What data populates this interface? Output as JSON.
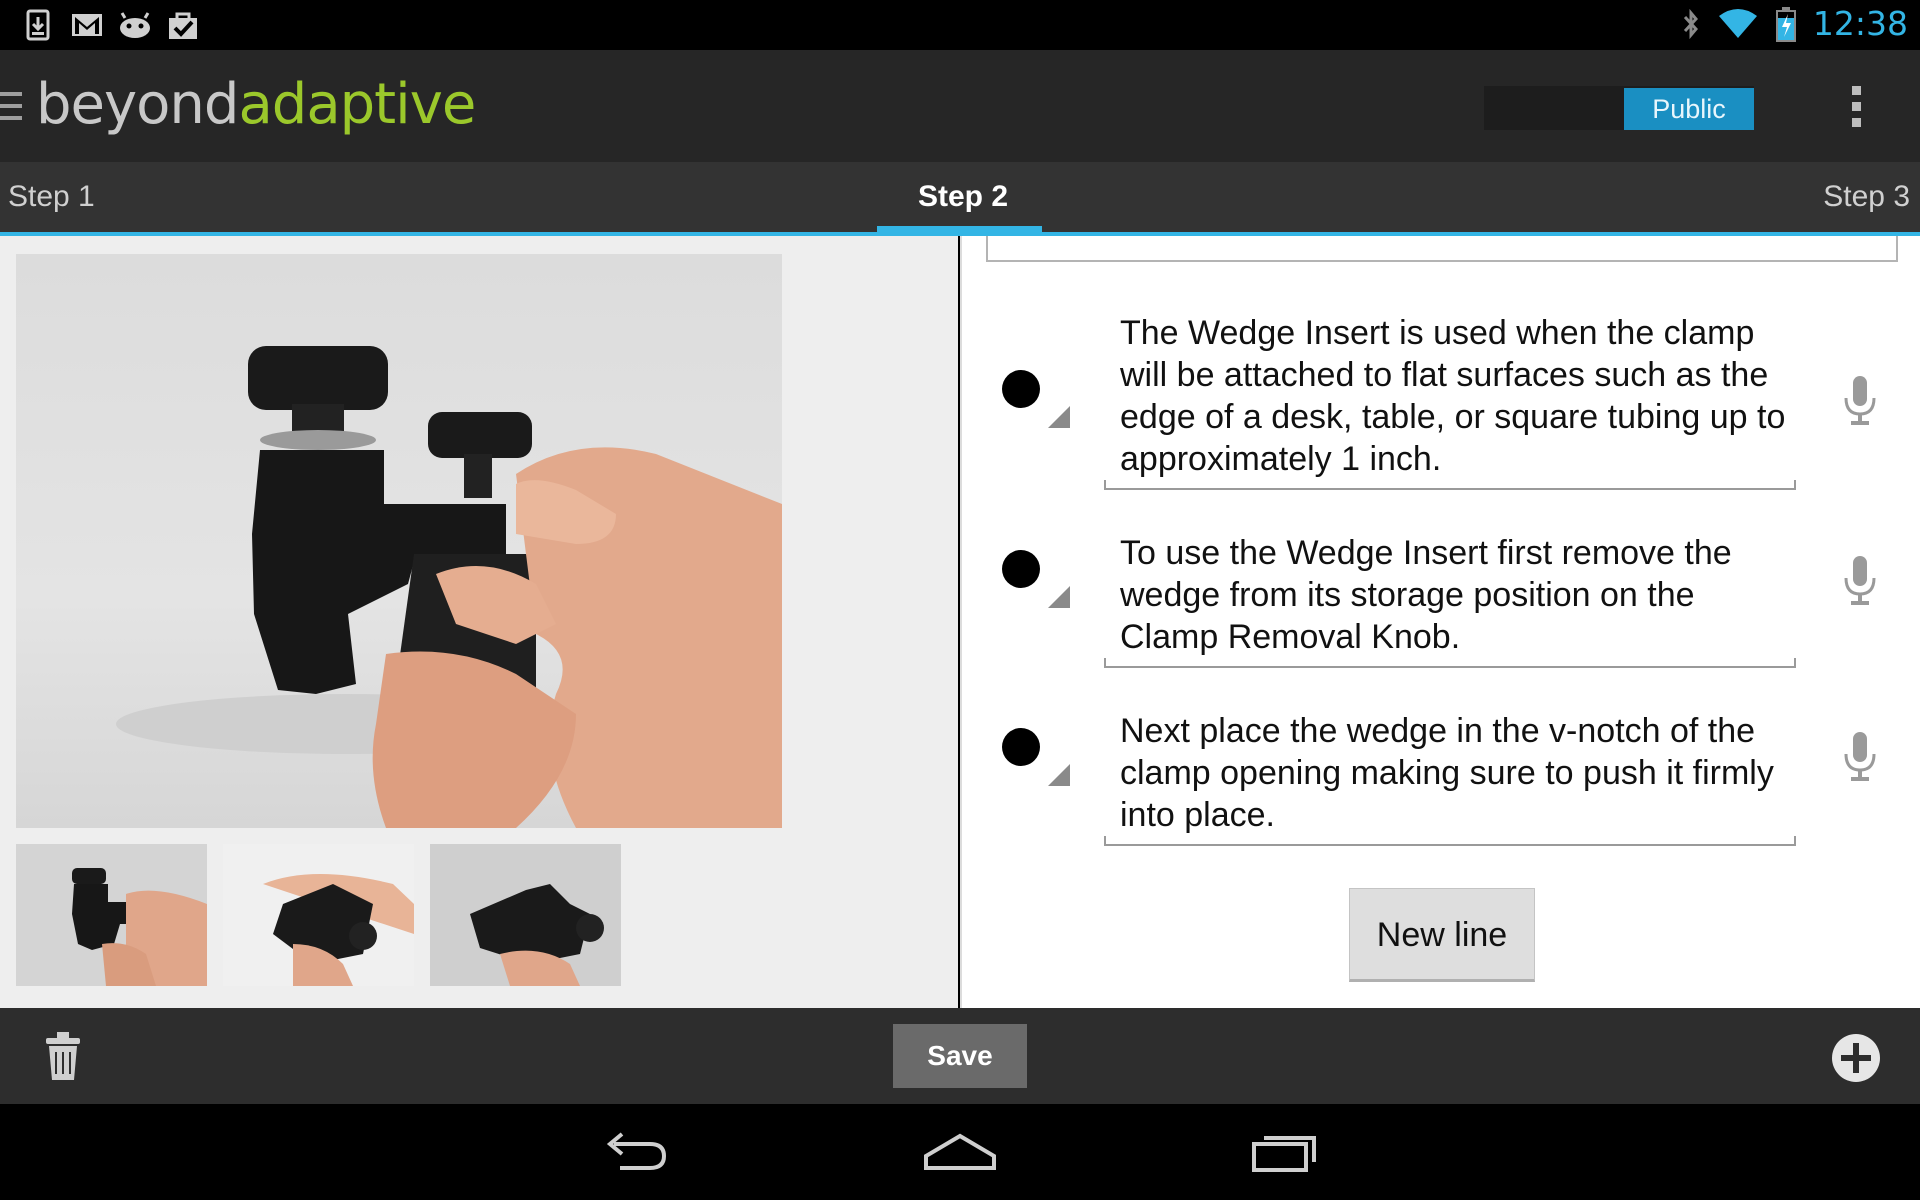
{
  "status_bar": {
    "time": "12:38",
    "notification_icons": [
      "download-icon",
      "gmail-icon",
      "android-icon",
      "shopping-bag-check-icon"
    ],
    "system_icons": [
      "bluetooth-icon",
      "wifi-icon",
      "battery-charging-icon"
    ],
    "accent_color": "#33b5e5"
  },
  "action_bar": {
    "logo_part1": "beyond",
    "logo_part2": "adaptive",
    "logo_colors": {
      "part1": "#c8c8c8",
      "part2": "#9bc82b"
    },
    "visibility_toggle": {
      "off_label": "",
      "on_label": "Public",
      "selected": "Public"
    }
  },
  "tabs": {
    "items": [
      {
        "label": "Step 1"
      },
      {
        "label": "Step 2",
        "selected": true
      },
      {
        "label": "Step 3"
      }
    ]
  },
  "gallery": {
    "main_image": "clamp-with-wedge-insert-photo",
    "thumbnails": [
      "clamp-thumbnail-1",
      "clamp-thumbnail-2",
      "clamp-thumbnail-3"
    ]
  },
  "steps": [
    {
      "text": "The Wedge Insert is used when the clamp will be attached to flat surfaces such as the edge of a desk, table, or square tubing up to approximately 1 inch."
    },
    {
      "text": "To use the Wedge Insert first remove the wedge from its storage position on the Clamp Removal Knob."
    },
    {
      "text": "Next place the wedge in the v-notch of the clamp opening making sure to push it firmly into place."
    }
  ],
  "buttons": {
    "new_line": "New line",
    "save": "Save"
  }
}
